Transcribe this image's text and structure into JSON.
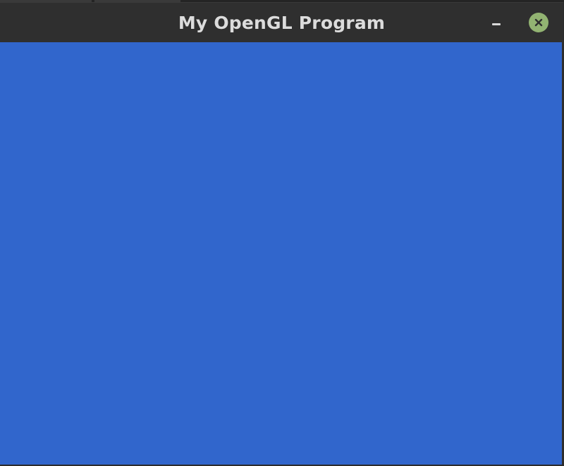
{
  "window": {
    "title": "My OpenGL Program",
    "clear_color": "#3166cc",
    "titlebar_color": "#2f2f2f",
    "title_color": "#dcdcdc"
  },
  "controls": {
    "minimize_icon": "minimize-icon",
    "close_icon": "close-icon",
    "close_bg_color": "#92b372"
  }
}
